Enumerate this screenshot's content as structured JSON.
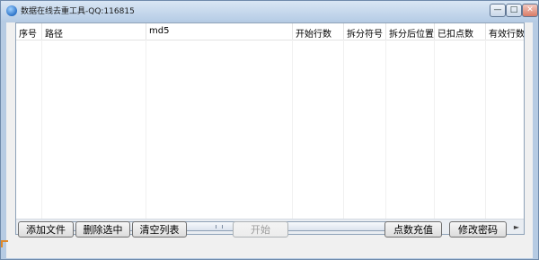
{
  "window": {
    "title": "数据在线去重工具-QQ:116815",
    "min_glyph": "—",
    "max_glyph": "□",
    "close_glyph": "✕"
  },
  "list": {
    "columns": [
      "序号",
      "路径",
      "md5",
      "开始行数",
      "拆分符号",
      "拆分后位置",
      "已扣点数",
      "有效行数"
    ],
    "rows": []
  },
  "scrollbar": {
    "left_arrow": "◄",
    "right_arrow": "►"
  },
  "buttons": {
    "add_file": "添加文件",
    "delete_selected": "删除选中",
    "clear_list": "清空列表",
    "start": "开始",
    "recharge": "点数充值",
    "change_password": "修改密码"
  },
  "colors": {
    "titlebar": "#c6d8ec",
    "client_bg": "#f0f0f0",
    "disabled_text": "#9c9c9c"
  }
}
